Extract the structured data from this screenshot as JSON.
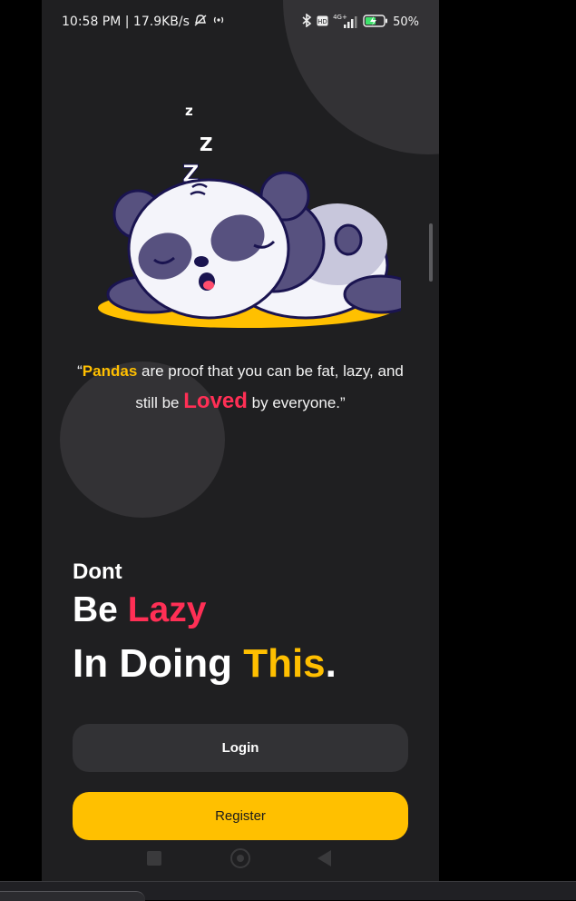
{
  "status_bar": {
    "time_speed": "10:58 PM | 17.9KB/s",
    "network": "4G+",
    "battery": "50%"
  },
  "quote": {
    "open": "“",
    "pandas": "Pandas",
    "part1": " are proof that you can be fat, lazy, and still be ",
    "loved": "Loved",
    "part2": " by everyone.”"
  },
  "headline": {
    "dont": "Dont",
    "be": "Be ",
    "lazy": "Lazy",
    "in_doing": "In Doing ",
    "this": "This",
    "period": "."
  },
  "buttons": {
    "login": "Login",
    "register": "Register"
  },
  "icons": [
    "bluetooth-icon",
    "volte-icon",
    "signal-icon",
    "battery-icon",
    "mute-icon",
    "hotspot-icon",
    "panda-illustration",
    "nav-recents-icon",
    "nav-home-icon",
    "nav-back-icon"
  ],
  "colors": {
    "background": "#1f1f21",
    "accent_yellow": "#ffc000",
    "accent_red": "#ff2f55",
    "button_dark": "#323235"
  }
}
